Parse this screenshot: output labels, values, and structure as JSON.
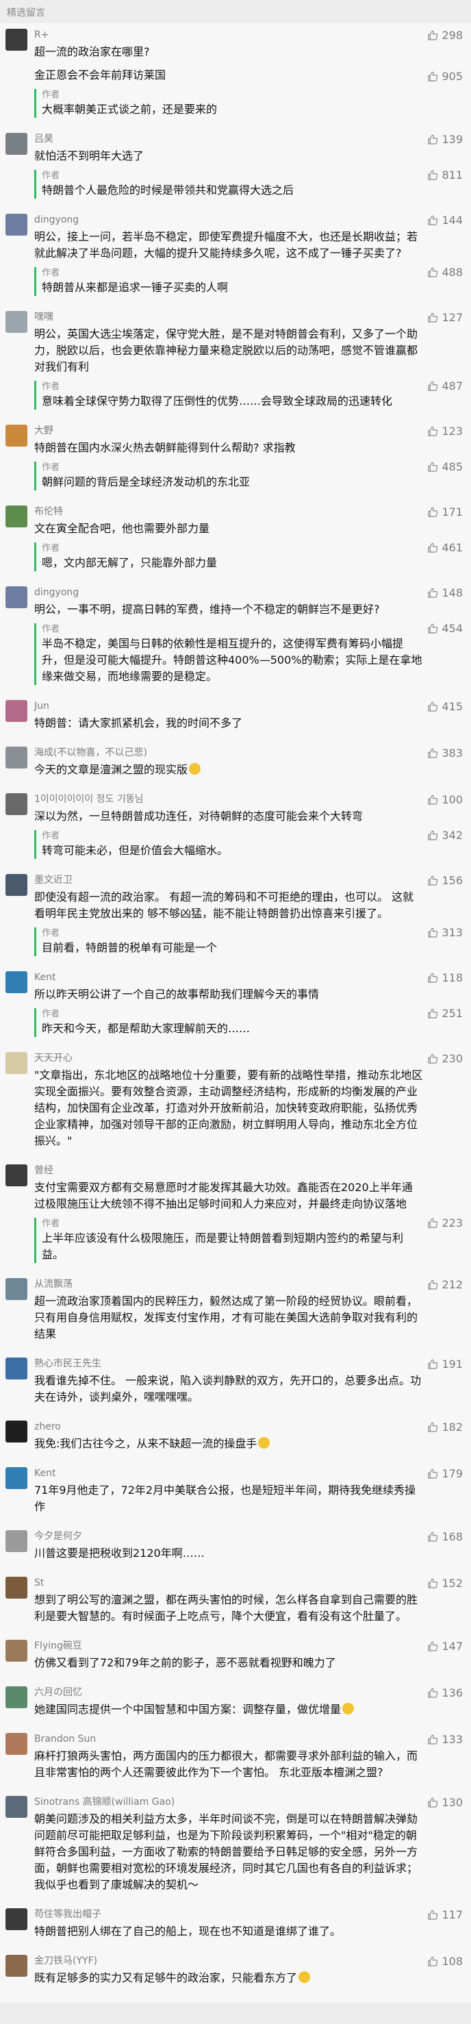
{
  "section_title": "精选留言",
  "comments": [
    {
      "nick": "R+",
      "text": "超一流的政治家在哪里?",
      "likes": "298",
      "avatar_color": "#3b3b3b",
      "extra_text": "金正恩会不会年前拜访莱国",
      "extra_likes": "905",
      "reply": {
        "head": "作者",
        "text": "大概率朝美正式谈之前，还是要来的",
        "likes": ""
      }
    },
    {
      "nick": "吕昊",
      "text": "就怕活不到明年大选了",
      "likes": "139",
      "avatar_color": "#7a7f86",
      "reply": {
        "head": "作者",
        "text": "特朗普个人最危险的时候是带领共和党赢得大选之后",
        "likes": "811"
      }
    },
    {
      "nick": "dingyong",
      "text": "明公，接上一问，若半岛不稳定，即使军费提升幅度不大，也还是长期收益；若就此解决了半岛问题，大幅的提升又能持续多久呢，这不成了一锤子买卖了?",
      "likes": "144",
      "avatar_color": "#6d7da0",
      "reply": {
        "head": "作者",
        "text": "特朗普从来都是追求一锤子买卖的人啊",
        "likes": "488"
      }
    },
    {
      "nick": "嘿嘿",
      "text": "明公，英国大选尘埃落定，保守党大胜，是不是对特朗普会有利，又多了一个助力，脱欧以后，也会更依靠神秘力量来稳定脱欧以后的动荡吧，感觉不管谁赢都对我们有利",
      "likes": "127",
      "avatar_color": "#9aa5ac",
      "reply": {
        "head": "作者",
        "text": "意味着全球保守势力取得了压倒性的优势……会导致全球政局的迅速转化",
        "likes": "487"
      }
    },
    {
      "nick": "大野",
      "text": "特朗普在国内水深火热去朝鲜能得到什么帮助? 求指教",
      "likes": "123",
      "avatar_color": "#c98a3b",
      "reply": {
        "head": "作者",
        "text": "朝鲜问题的背后是全球经济发动机的东北亚",
        "likes": "485"
      }
    },
    {
      "nick": "布伦特",
      "text": "文在寅全配合吧，他也需要外部力量",
      "likes": "171",
      "avatar_color": "#5e8c4d",
      "reply": {
        "head": "作者",
        "text": "嗯，文内部无解了，只能靠外部力量",
        "likes": "461"
      }
    },
    {
      "nick": "dingyong",
      "text": "明公，一事不明，提高日韩的军费，维持一个不稳定的朝鲜岂不是更好?",
      "likes": "148",
      "avatar_color": "#6d7da0",
      "reply": {
        "head": "作者",
        "text": "半岛不稳定，美国与日韩的依赖性是相互提升的，这使得军费有筹码小幅提升，但是没可能大幅提升。特朗普这种400%—500%的勒索；实际上是在拿地缘来做交易，而地缘需要的是稳定。",
        "likes": "454"
      }
    },
    {
      "nick": "Jun",
      "text": "特朗普：请大家抓紧机会，我的时间不多了",
      "likes": "415",
      "avatar_color": "#b36a8a"
    },
    {
      "nick": "海成(不以物喜，不以己悲)",
      "text": "今天的文章是澶渊之盟的现实版",
      "text_emoji": true,
      "likes": "383",
      "avatar_color": "#8a8f95"
    },
    {
      "nick": "1이이이이이이 정도 기똥님",
      "text": "深以为然，一旦特朗普成功连任，对待朝鲜的态度可能会来个大转弯",
      "likes": "100",
      "avatar_color": "#6a6a6a",
      "reply": {
        "head": "作者",
        "text": "转弯可能未必，但是价值会大幅缩水。",
        "likes": "342"
      }
    },
    {
      "nick": "墨文近卫",
      "text": "即使没有超一流的政治家。 有超一流的筹码和不可拒绝的理由，也可以。 这就看明年民主党放出来的 够不够凶猛，能不能让特朗普扔出惊喜来引援了。",
      "likes": "156",
      "avatar_color": "#4a5a6d",
      "reply": {
        "head": "作者",
        "text": "目前看，特朗普的税单有可能是一个",
        "likes": "313"
      }
    },
    {
      "nick": "Kent",
      "text": "所以昨天明公讲了一个自己的故事帮助我们理解今天的事情",
      "likes": "118",
      "avatar_color": "#2f7fb5",
      "reply": {
        "head": "作者",
        "text": "昨天和今天，都是帮助大家理解前天的……",
        "likes": "251"
      }
    },
    {
      "nick": "天天开心",
      "text": "\"文章指出，东北地区的战略地位十分重要，要有新的战略性举措，推动东北地区实现全面振兴。要有效整合资源，主动调整经济结构，形成新的均衡发展的产业结构，加快国有企业改革，打造对外开放新前沿，加快转变政府职能，弘扬优秀企业家精神，加强对领导干部的正向激励，树立鲜明用人导向，推动东北全方位振兴。\"",
      "likes": "230",
      "avatar_color": "#d8c9a6"
    },
    {
      "nick": "曾经",
      "text": "支付宝需要双方都有交易意愿时才能发挥其最大功效。鑫能否在2020上半年通过极限施压让大统领不得不抽出足够时间和人力来应对，并最终走向协议落地",
      "likes": "",
      "avatar_color": "#3b3b3b",
      "reply": {
        "head": "作者",
        "text": "上半年应该没有什么极限施压，而是要让特朗普看到短期内签约的希望与利益。",
        "likes": "223"
      }
    },
    {
      "nick": "从流飘荡",
      "text": "超一流政治家顶着国内的民粹压力，毅然达成了第一阶段的经贸协议。眼前看，只有用自身信用赋权，发挥支付宝作用，才有可能在美国大选前争取对我有利的结果",
      "likes": "212",
      "avatar_color": "#6e8797"
    },
    {
      "nick": "熟心市民王先生",
      "text": "我看谁先掉不住。 一般来说，陷入谈判静默的双方，先开口的，总要多出点。功夫在诗外，谈判桌外，嘿嘿嘿嘿。",
      "likes": "191",
      "avatar_color": "#3a6ea5"
    },
    {
      "nick": "zhero",
      "text": "我免:我们古往今之，从来不缺超一流的操盘手",
      "text_emoji": true,
      "likes": "182",
      "avatar_color": "#1f1f1f"
    },
    {
      "nick": "Kent",
      "text": "71年9月他走了，72年2月中美联合公报，也是短短半年间，期待我免继续秀操作",
      "likes": "179",
      "avatar_color": "#2f7fb5"
    },
    {
      "nick": "今夕是何夕",
      "text": "川普这要是把税收到2120年啊……",
      "likes": "168",
      "avatar_color": "#9a9a9a"
    },
    {
      "nick": "St",
      "text": "想到了明公写的澶渊之盟，都在两头害怕的时候，怎么样各自拿到自己需要的胜利是要大智慧的。有时候面子上吃点亏，降个大便宜，看有没有这个肚量了。",
      "likes": "152",
      "avatar_color": "#7a5b3e"
    },
    {
      "nick": "Flying碗豆",
      "text": "仿佛又看到了72和79年之前的影子，恶不恶就看视野和魄力了",
      "likes": "147",
      "avatar_color": "#9a7a5a"
    },
    {
      "nick": "六月の回忆",
      "text": "她建国同志提供一个中国智慧和中国方案：调整存量，做优增量",
      "text_emoji": true,
      "likes": "136",
      "avatar_color": "#5b8a6a"
    },
    {
      "nick": "Brandon Sun",
      "text": "麻杆打狼两头害怕，两方面国内的压力都很大，都需要寻求外部利益的输入，而且非常害怕的两个人还需要彼此作为下一个害怕。 东北亚版本檀渊之盟?",
      "likes": "133",
      "avatar_color": "#b07a5a"
    },
    {
      "nick": "Sinotrans 高锦顺(william Gao)",
      "text": "朝美问题涉及的相关利益方太多，半年时间谈不完，倒是可以在特朗普解决弹劾问题前尽可能把取足够利益，也是为下阶段谈判积累筹码，一个\"相对\"稳定的朝鲜符合多国利益，一方面收了勒索的特朗普要给予日韩足够的安全感，另外一方面，朝鲜也需要相对宽松的环境发展经济，同时其它几国也有各自的利益诉求；我似乎也看到了康城解决的契机～",
      "likes": "130",
      "avatar_color": "#5a6a7a"
    },
    {
      "nick": "苟住等我出帽子",
      "text": "特朗普把别人绑在了自己的船上，现在也不知道是谁绑了谁了。",
      "likes": "117",
      "avatar_color": "#3a3a3a"
    },
    {
      "nick": "金刀铁马(YYF)",
      "text": "既有足够多的实力又有足够牛的政治家，只能看东方了",
      "text_emoji": true,
      "likes": "108",
      "avatar_color": "#8a6a4a"
    }
  ]
}
